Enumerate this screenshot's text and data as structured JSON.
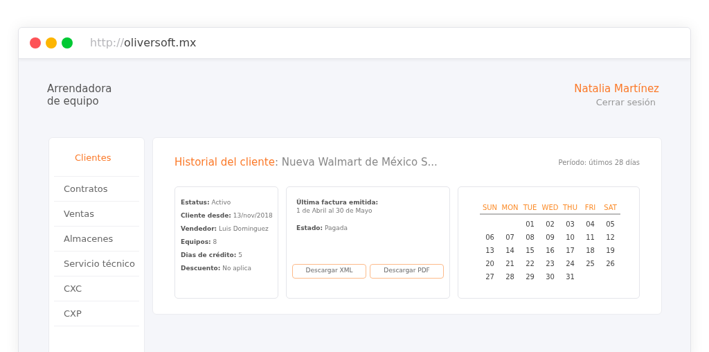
{
  "browser": {
    "url_scheme": "http://",
    "url_host": "oliversoft.mx"
  },
  "company": {
    "line_1": "Arrendadora",
    "line_2": "de equipo"
  },
  "user": {
    "name": "Natalia Martínez",
    "logout": "Cerrar sesión"
  },
  "sidebar": {
    "items": [
      {
        "label": "Clientes",
        "selected": true
      },
      {
        "label": "Contratos",
        "selected": false
      },
      {
        "label": "Ventas",
        "selected": false
      },
      {
        "label": "Almacenes",
        "selected": false
      },
      {
        "label": "Servicio técnico",
        "selected": false
      },
      {
        "label": "CXC",
        "selected": false
      },
      {
        "label": "CXP",
        "selected": false
      }
    ]
  },
  "main": {
    "title": "Historial del cliente",
    "client": ": Nueva Walmart de México S...",
    "period": "Período: útimos 28 días",
    "details": [
      {
        "label": "Estatus:",
        "value": "Activo"
      },
      {
        "label": "Cliente desde:",
        "value": "13/nov/2018"
      },
      {
        "label": "Vendedor:",
        "value": "Luis Dominguez"
      },
      {
        "label": "Equipos:",
        "value": "8"
      },
      {
        "label": "Dias de crédito:",
        "value": "5"
      },
      {
        "label": "Descuento:",
        "value": "No aplica"
      }
    ],
    "invoice": {
      "label": "Última factura emitida:",
      "range": "1 de Abril al 30 de Mayo",
      "status_label": "Estado:",
      "status": "Pagada",
      "buttons": [
        "Descargar XML",
        "Descargar PDF"
      ]
    },
    "calendar": {
      "weekdays": [
        "SUN",
        "MON",
        "TUE",
        "WED",
        "THU",
        "FRI",
        "SAT"
      ],
      "weeks": [
        [
          "01",
          "02",
          "03",
          "04",
          "05"
        ],
        [
          "06",
          "07",
          "08",
          "09",
          "10",
          "11",
          "12"
        ],
        [
          "13",
          "14",
          "15",
          "16",
          "17",
          "18",
          "19"
        ],
        [
          "20",
          "21",
          "22",
          "23",
          "24",
          "25",
          "26"
        ],
        [
          "27",
          "28",
          "29",
          "30",
          "31"
        ]
      ]
    }
  }
}
